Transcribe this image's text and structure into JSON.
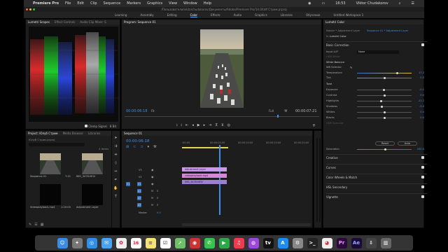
{
  "menubar": {
    "app_name": "Premiere Pro",
    "items": [
      "File",
      "Edit",
      "Clip",
      "Sequence",
      "Markers",
      "Graphics",
      "View",
      "Window",
      "Help"
    ],
    "clock": "16:53",
    "user": "Viktor Chudakorov"
  },
  "window": {
    "title": "/Пользователи/viktorchudakorov/Документы/Adobe/Premiere Pro/14.0/Udf Стрим.prproj"
  },
  "workspaces": {
    "tabs": [
      "Learning",
      "Assembly",
      "Editing",
      "Color",
      "Effects",
      "Audio",
      "Graphics",
      "Libraries",
      "Обучение",
      "Untitled Workspace 1"
    ],
    "active": "Color"
  },
  "scopes": {
    "tabs": [
      "Lumetri Scopes",
      "Effect Controls",
      "Audio Clip Mixer: S"
    ],
    "clamp_label": "Clamp Signal",
    "bit_label": "8 Bit"
  },
  "program": {
    "title": "Program: Sequence 01",
    "timecode": "00:00:06:18",
    "duration": "00:00:07:21",
    "fit": "Fit",
    "quality": "Full"
  },
  "project": {
    "tabs": [
      "Project: Юлуб Стрим",
      "Media Browser",
      "Libraries"
    ],
    "file_name": "Юлуб Стрим.prproj",
    "item_count": "4 Items",
    "items": [
      {
        "name": "Sequence 01",
        "duration": "7:21"
      },
      {
        "name": "IMG_3478.MOV",
        "duration": "7:21"
      },
      {
        "name": "Videoplayback.mp4",
        "duration": "1:20:00"
      },
      {
        "name": "Adjustment Layer",
        "duration": "5:00"
      }
    ]
  },
  "timeline": {
    "title": "Sequence 01",
    "timecode": "00:00:06:18",
    "ruler": [
      ":00:00",
      "00:00:05:00",
      "00:00:10:00",
      "00:00:15:00",
      "00:00:20:00"
    ],
    "video_tracks": [
      "V3",
      "V2",
      "V1"
    ],
    "audio_tracks": [
      "A1",
      "A2",
      "A3"
    ],
    "master_label": "Master",
    "master_value": "0.0",
    "clips": [
      {
        "name": "Adjustment Layer",
        "track": "V3"
      },
      {
        "name": "videoplayback.mp4",
        "track": "V2"
      },
      {
        "name": "IMG_3478.MOV",
        "track": "V1"
      }
    ]
  },
  "lumetri": {
    "title": "Lumetri Color",
    "source": "Master * Adjustment Layer",
    "sequence": "Sequence 01 * Adjustment Layer",
    "fx_name": "Lumetri Color",
    "basic_correction": "Basic Correction",
    "input_lut_label": "Input LUT",
    "input_lut_value": "None",
    "hdr_label": "HDR White",
    "white_balance": "White Balance",
    "wb_selector": "WB Selector",
    "tone": "Tone",
    "sliders": [
      {
        "label": "Temperature",
        "value": "17.2",
        "pos": 0.74
      },
      {
        "label": "Tint",
        "value": "0.0",
        "pos": 0.5
      },
      {
        "label": "Exposure",
        "value": "-0.1",
        "pos": 0.49
      },
      {
        "label": "Contrast",
        "value": "0.0",
        "pos": 0.5
      },
      {
        "label": "Highlights",
        "value": "-11.2",
        "pos": 0.44
      },
      {
        "label": "Shadows",
        "value": "-9.0",
        "pos": 0.46
      },
      {
        "label": "Whites",
        "value": "0.0",
        "pos": 0.5
      },
      {
        "label": "Blacks",
        "value": "0.0",
        "pos": 0.5
      }
    ],
    "hdr_specular": "HDR Specular",
    "reset_label": "Reset",
    "auto_label": "Auto",
    "saturation_label": "Saturation",
    "saturation_value": "100.0",
    "sections": [
      "Creative",
      "Curves",
      "Color Wheels & Match",
      "HSL Secondary",
      "Vignette"
    ]
  },
  "colors": {
    "accent": "#3f8ff0",
    "clip_purple": "#c89ae8",
    "clip_pink": "#d18ad3",
    "clip_violet": "#9c7fd0",
    "playhead": "#3f8ff0"
  },
  "dock": {
    "icons": [
      "finder-icon",
      "launchpad-icon",
      "safari-icon",
      "mail-icon",
      "photos-icon",
      "calendar-icon",
      "notes-icon",
      "reminders-icon",
      "maps-icon",
      "photo-booth-icon",
      "messages-icon",
      "facetime-icon",
      "music-icon",
      "podcasts-icon",
      "tv-icon",
      "appstore-icon",
      "preferences-icon",
      "terminal-icon",
      "chrome-icon",
      "premiere-icon",
      "aftereffects-icon",
      "downloads-icon",
      "trash-icon"
    ]
  }
}
